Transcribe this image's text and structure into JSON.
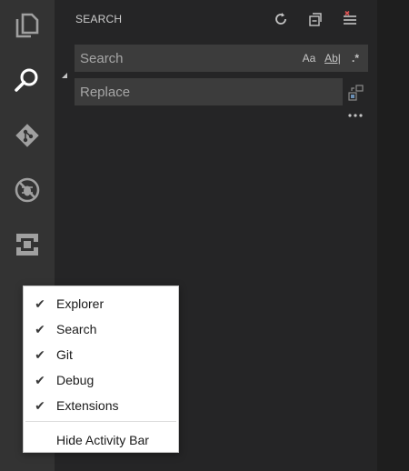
{
  "activity_bar": {
    "items": [
      {
        "name": "explorer",
        "icon": "files-icon",
        "active": false
      },
      {
        "name": "search",
        "icon": "search-icon",
        "active": true
      },
      {
        "name": "git",
        "icon": "git-icon",
        "active": false
      },
      {
        "name": "debug",
        "icon": "debug-icon",
        "active": false
      },
      {
        "name": "extensions",
        "icon": "extensions-icon",
        "active": false
      }
    ]
  },
  "sidebar": {
    "title": "SEARCH",
    "actions": [
      {
        "name": "refresh",
        "icon": "refresh-icon"
      },
      {
        "name": "collapse-all",
        "icon": "collapse-all-icon"
      },
      {
        "name": "clear-results",
        "icon": "clear-results-icon"
      }
    ]
  },
  "search": {
    "placeholder": "Search",
    "value": "",
    "match_case_label": "Aa",
    "whole_word_label": "Ab|",
    "regex_label": ".*"
  },
  "replace": {
    "placeholder": "Replace",
    "value": ""
  },
  "context_menu": {
    "items": [
      {
        "label": "Explorer",
        "checked": true
      },
      {
        "label": "Search",
        "checked": true
      },
      {
        "label": "Git",
        "checked": true
      },
      {
        "label": "Debug",
        "checked": true
      },
      {
        "label": "Extensions",
        "checked": true
      }
    ],
    "hide_label": "Hide Activity Bar",
    "check_glyph": "✔"
  },
  "colors": {
    "activity_bar_bg": "#333333",
    "sidebar_bg": "#252526",
    "input_bg": "#3c3c3c",
    "icon_active": "#ffffff",
    "icon_inactive": "#a0a0a0",
    "menu_bg": "#ffffff"
  }
}
